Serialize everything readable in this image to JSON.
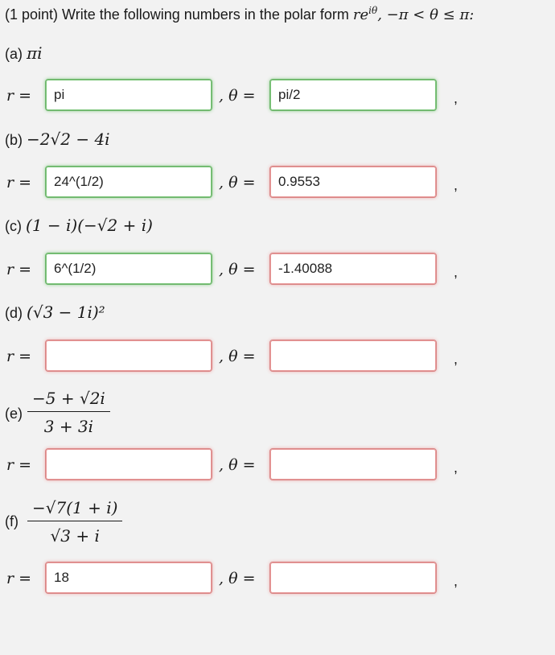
{
  "header": {
    "prefix": "(1 point) Write the following numbers in the polar form ",
    "form": "re",
    "exp": "iθ",
    "suffix": ", −π < θ ≤ π:"
  },
  "labels": {
    "r": "r =",
    "theta": "θ =",
    "comma": ","
  },
  "parts": [
    {
      "id": "a",
      "label": "(a)",
      "expr": "πi",
      "r": "pi",
      "theta": "pi/2",
      "r_status": "correct",
      "theta_status": "correct"
    },
    {
      "id": "b",
      "label": "(b)",
      "expr": "−2√2  −  4i",
      "r": "24^(1/2)",
      "theta": "0.9553",
      "r_status": "correct",
      "theta_status": "incorrect"
    },
    {
      "id": "c",
      "label": "(c)",
      "expr": "(1  −  i)(−√2  +  i)",
      "r": "6^(1/2)",
      "theta": "-1.40088",
      "r_status": "correct",
      "theta_status": "incorrect"
    },
    {
      "id": "d",
      "label": "(d)",
      "expr": "(√3  −  1i)²",
      "r": "",
      "theta": "",
      "r_status": "incorrect",
      "theta_status": "incorrect"
    },
    {
      "id": "e",
      "label": "(e)",
      "num": "−5  +  √2i",
      "den": "3  +  3i",
      "r": "",
      "theta": "",
      "r_status": "incorrect",
      "theta_status": "incorrect"
    },
    {
      "id": "f",
      "label": "(f)",
      "num": "−√7(1  +  i)",
      "den": "√3  +  i",
      "r": "18",
      "theta": "",
      "r_status": "incorrect",
      "theta_status": "incorrect"
    }
  ],
  "colors": {
    "correct": "#6db56b",
    "incorrect": "#d88585"
  }
}
